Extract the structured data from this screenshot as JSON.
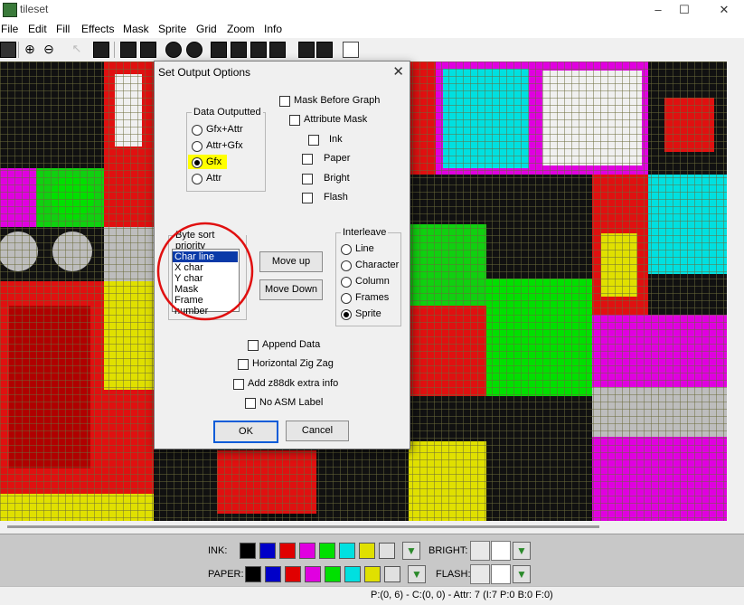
{
  "window": {
    "title": "tileset",
    "controls": [
      "–",
      "☐",
      "✕"
    ]
  },
  "menu": [
    "File",
    "Edit",
    "Fill",
    "Effects",
    "Mask",
    "Sprite",
    "Grid",
    "Zoom",
    "Info"
  ],
  "toolbar": {
    "icons": [
      "save-icon",
      "zoom-in-icon",
      "zoom-out-icon",
      "pointer-icon",
      "invert-icon",
      "flip-horizontal-icon",
      "flip-vertical-icon",
      "rotate-left-icon",
      "rotate-right-icon",
      "shift-up-icon",
      "shift-down-icon",
      "shift-left-icon",
      "shift-right-icon",
      "previous-frame-icon",
      "next-frame-icon",
      "new-page-icon"
    ]
  },
  "dialog": {
    "title": "Set Output Options",
    "data_outputted": {
      "legend": "Data Outputted",
      "options": [
        "Gfx+Attr",
        "Attr+Gfx",
        "Gfx",
        "Attr"
      ],
      "selected": "Gfx"
    },
    "mask_before_graph": "Mask Before Graph",
    "attribute_mask": "Attribute Mask",
    "attr_checks": [
      "Ink",
      "Paper",
      "Bright",
      "Flash"
    ],
    "byte_sort": {
      "legend": "Byte sort priority",
      "items": [
        "Char line",
        "X char",
        "Y char",
        "Mask",
        "Frame number"
      ],
      "selected": "Char line"
    },
    "move_up": "Move up",
    "move_down": "Move Down",
    "interleave": {
      "legend": "Interleave",
      "options": [
        "Line",
        "Character",
        "Column",
        "Frames",
        "Sprite"
      ],
      "selected": "Sprite"
    },
    "bottom_checks": [
      "Append Data",
      "Horizontal Zig Zag",
      "Add z88dk extra info",
      "No ASM Label"
    ],
    "ok": "OK",
    "cancel": "Cancel",
    "highlight_color": "#ffff00",
    "annotation_color": "#e01010"
  },
  "palette": {
    "ink_label": "INK:",
    "paper_label": "PAPER:",
    "bright_label": "BRIGHT:",
    "flash_label": "FLASH:",
    "colors": [
      "#000000",
      "#0000c8",
      "#e00000",
      "#e000e0",
      "#00e000",
      "#00e0e0",
      "#e0e000",
      "#e0e0e0"
    ]
  },
  "status": {
    "text": "P:(0, 6) - C:(0, 0) - Attr: 7 (I:7 P:0 B:0 F:0)"
  }
}
